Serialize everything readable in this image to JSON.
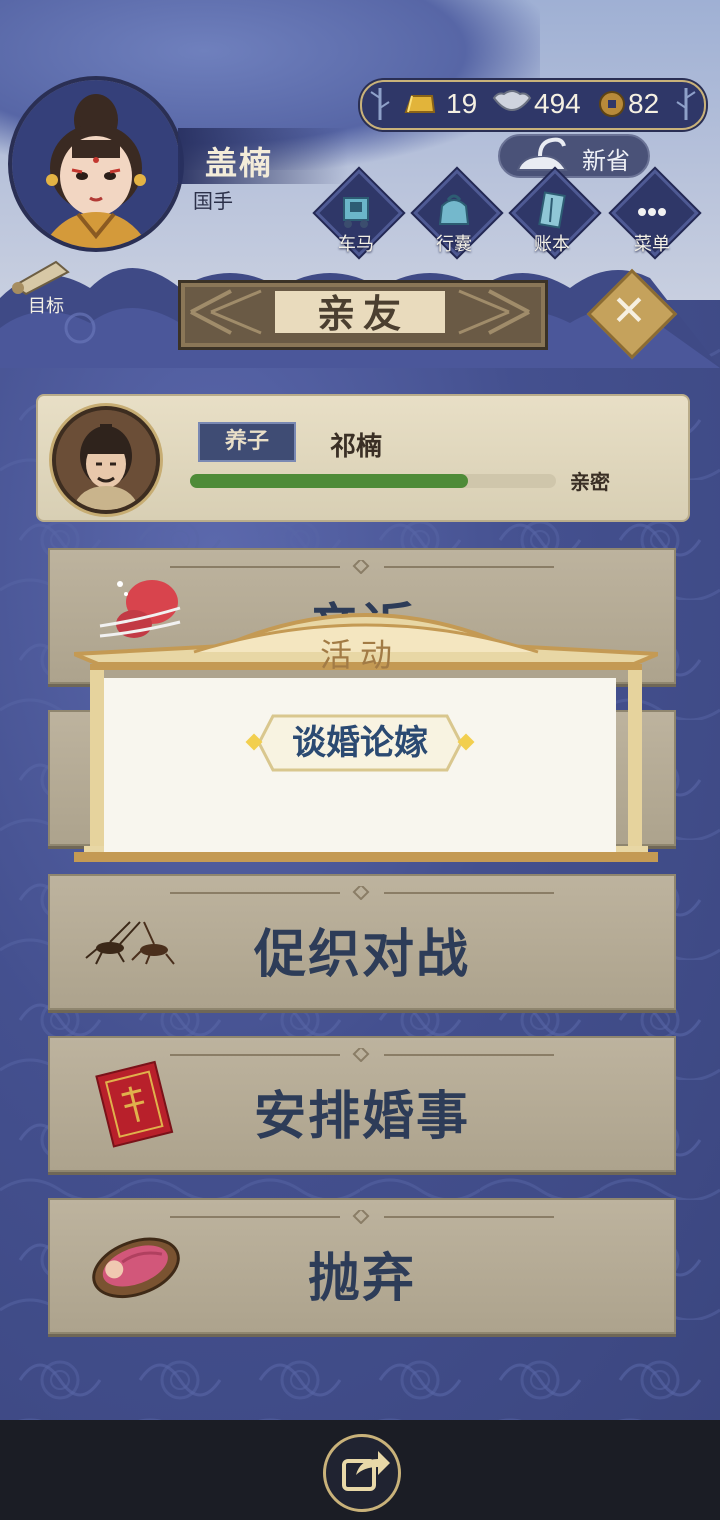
{
  "player": {
    "name": "盖楠",
    "title": "国手"
  },
  "currency": {
    "gold": "19",
    "silver": "494",
    "coins": "82"
  },
  "header_button": {
    "label": "新省"
  },
  "nav": {
    "items": [
      {
        "label": "车马",
        "icon": "carriage-icon"
      },
      {
        "label": "行囊",
        "icon": "bag-icon"
      },
      {
        "label": "账本",
        "icon": "ledger-icon"
      },
      {
        "label": "菜单",
        "icon": "menu-dots-icon"
      }
    ]
  },
  "goal": {
    "label": "目标"
  },
  "page": {
    "title": "亲友"
  },
  "child": {
    "relation": "养子",
    "name": "祁楠",
    "intimacy_label": "亲密",
    "intimacy_fraction": 0.76
  },
  "actions": [
    {
      "label": "亲近",
      "icon": "lantern-icon"
    },
    {
      "label": "",
      "icon": ""
    },
    {
      "label": "促织对战",
      "icon": "cricket-icon"
    },
    {
      "label": "安排婚事",
      "icon": "red-envelope-icon"
    },
    {
      "label": "抛弃",
      "icon": "cradle-icon"
    }
  ],
  "popup": {
    "title": "活动",
    "button": "谈婚论嫁"
  },
  "colors": {
    "background": "#44508f",
    "gold_trim": "#c9b27a",
    "panel": "#b6ac96",
    "intimacy_bar": "#4e8b38"
  }
}
